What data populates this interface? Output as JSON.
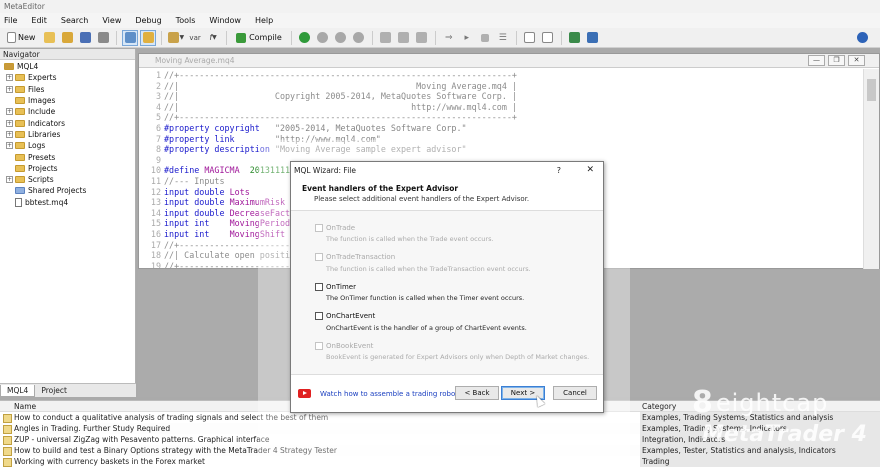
{
  "app": {
    "title": "MetaEditor"
  },
  "menu": [
    "File",
    "Edit",
    "Search",
    "View",
    "Debug",
    "Tools",
    "Window",
    "Help"
  ],
  "toolbar": {
    "new_label": "New",
    "compile_label": "Compile"
  },
  "navigator": {
    "title": "Navigator",
    "root": "MQL4",
    "items": [
      {
        "label": "Experts",
        "type": "folder"
      },
      {
        "label": "Files",
        "type": "folder"
      },
      {
        "label": "Images",
        "type": "folder"
      },
      {
        "label": "Include",
        "type": "folder"
      },
      {
        "label": "Indicators",
        "type": "folder"
      },
      {
        "label": "Libraries",
        "type": "folder"
      },
      {
        "label": "Logs",
        "type": "folder"
      },
      {
        "label": "Presets",
        "type": "folder"
      },
      {
        "label": "Projects",
        "type": "folder"
      },
      {
        "label": "Scripts",
        "type": "folder"
      },
      {
        "label": "Shared Projects",
        "type": "folder"
      },
      {
        "label": "bbtest.mq4",
        "type": "file"
      }
    ],
    "tabs": [
      "MQL4",
      "Project"
    ]
  },
  "editor": {
    "title": "Moving Average.mq4",
    "lines": [
      {
        "n": "1",
        "parts": [
          {
            "c": "c-cmt",
            "t": "//+------------------------------------------------------------------+"
          }
        ]
      },
      {
        "n": "2",
        "parts": [
          {
            "c": "c-cmt",
            "t": "//|                                               Moving Average.mq4 |"
          }
        ]
      },
      {
        "n": "3",
        "parts": [
          {
            "c": "c-cmt",
            "t": "//|                   Copyright 2005-2014, MetaQuotes Software Corp. |"
          }
        ]
      },
      {
        "n": "4",
        "parts": [
          {
            "c": "c-cmt",
            "t": "//|                                              http://www.mql4.com |"
          }
        ]
      },
      {
        "n": "5",
        "parts": [
          {
            "c": "c-cmt",
            "t": "//+------------------------------------------------------------------+"
          }
        ]
      },
      {
        "n": "6",
        "parts": [
          {
            "c": "c-kw",
            "t": "#property copyright   "
          },
          {
            "c": "c-str",
            "t": "\"2005-2014, MetaQuotes Software Corp.\""
          }
        ]
      },
      {
        "n": "7",
        "parts": [
          {
            "c": "c-kw",
            "t": "#property link        "
          },
          {
            "c": "c-str",
            "t": "\"http://www.mql4.com\""
          }
        ]
      },
      {
        "n": "8",
        "parts": [
          {
            "c": "c-kw",
            "t": "#property description "
          },
          {
            "c": "c-str",
            "t": "\"Moving Average sample expert advisor\""
          }
        ]
      },
      {
        "n": "9",
        "parts": []
      },
      {
        "n": "10",
        "parts": [
          {
            "c": "c-kw",
            "t": "#define "
          },
          {
            "c": "c-mac",
            "t": "MAGICMA  "
          },
          {
            "c": "c-num",
            "t": "20131111"
          }
        ]
      },
      {
        "n": "11",
        "parts": [
          {
            "c": "c-cmt",
            "t": "//--- Inputs"
          }
        ]
      },
      {
        "n": "12",
        "parts": [
          {
            "c": "c-type",
            "t": "input double "
          },
          {
            "c": "c-mac",
            "t": "Lots"
          }
        ]
      },
      {
        "n": "13",
        "parts": [
          {
            "c": "c-type",
            "t": "input double "
          },
          {
            "c": "c-mac",
            "t": "MaximumRisk"
          }
        ]
      },
      {
        "n": "14",
        "parts": [
          {
            "c": "c-type",
            "t": "input double "
          },
          {
            "c": "c-mac",
            "t": "DecreaseFact"
          }
        ]
      },
      {
        "n": "15",
        "parts": [
          {
            "c": "c-type",
            "t": "input int    "
          },
          {
            "c": "c-mac",
            "t": "MovingPeriod"
          }
        ]
      },
      {
        "n": "16",
        "parts": [
          {
            "c": "c-type",
            "t": "input int    "
          },
          {
            "c": "c-mac",
            "t": "MovingShift"
          }
        ]
      },
      {
        "n": "17",
        "parts": [
          {
            "c": "c-cmt",
            "t": "//+------------------------------------"
          }
        ]
      },
      {
        "n": "18",
        "parts": [
          {
            "c": "c-cmt",
            "t": "//| Calculate open positi"
          }
        ]
      },
      {
        "n": "19",
        "parts": [
          {
            "c": "c-cmt",
            "t": "//+------------------------------------"
          }
        ]
      }
    ]
  },
  "dialog": {
    "title": "MQL Wizard: File",
    "help": "?",
    "close": "✕",
    "heading": "Event handlers of the Expert Advisor",
    "subheading": "Please select additional event handlers of the Expert Advisor.",
    "options": [
      {
        "label": "OnTrade",
        "desc": "The function is called when the Trade event occurs.",
        "enabled": false,
        "checked": false
      },
      {
        "label": "OnTradeTransaction",
        "desc": "The function is called when the TradeTransaction event occurs.",
        "enabled": false,
        "checked": false
      },
      {
        "label": "OnTimer",
        "desc": "The OnTimer function is called when the Timer event occurs.",
        "enabled": true,
        "checked": false
      },
      {
        "label": "OnChartEvent",
        "desc": "OnChartEvent is the handler of a group of ChartEvent events.",
        "enabled": true,
        "checked": false
      },
      {
        "label": "OnBookEvent",
        "desc": "BookEvent is generated for Expert Advisors only when Depth of Market changes.",
        "enabled": false,
        "checked": false
      }
    ],
    "video_link": "Watch how to assemble a trading robot",
    "back_label": "< Back",
    "next_label": "Next >",
    "cancel_label": "Cancel"
  },
  "toolbox": {
    "columns": {
      "name": "Name",
      "category": "Category"
    },
    "rows": [
      {
        "name": "How to conduct a qualitative analysis of trading signals and select the best of them",
        "category": "Examples, Trading Systems, Statistics and analysis"
      },
      {
        "name": "Angles in Trading. Further Study Required",
        "category": "Examples, Trading Systems, Indicators"
      },
      {
        "name": "ZUP - universal ZigZag with Pesavento patterns. Graphical interface",
        "category": "Integration, Indicators"
      },
      {
        "name": "How to build and test a Binary Options strategy with the MetaTrader 4 Strategy Tester",
        "category": "Examples, Tester, Statistics and analysis, Indicators"
      },
      {
        "name": "Working with currency baskets in the Forex market",
        "category": "Trading"
      }
    ]
  },
  "watermark": {
    "brand_mark": "8",
    "brand": "eightcap",
    "product": "MetaTrader 4"
  }
}
